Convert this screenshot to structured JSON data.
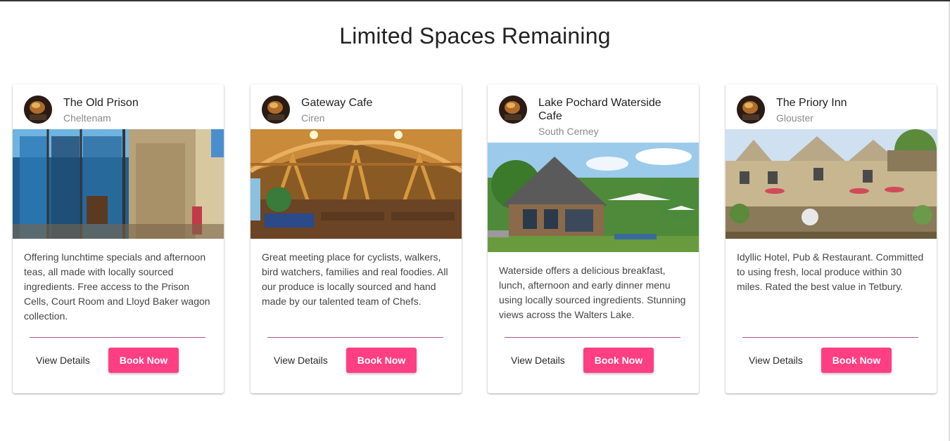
{
  "page": {
    "title": "Limited Spaces Remaining"
  },
  "cards": [
    {
      "title": "The Old Prison",
      "subtitle": "Cheltenam",
      "description": "Offering lunchtime specials and afternoon teas, all made with locally sourced ingredients. Free access to the Prison Cells, Court Room and Lloyd Baker wagon collection.",
      "view_label": "View Details",
      "book_label": "Book Now",
      "image": "cafe-exterior-photo"
    },
    {
      "title": "Gateway Cafe",
      "subtitle": "Ciren",
      "description": "Great meeting place for cyclists, walkers, bird watchers, families and real foodies. All our produce is locally sourced and hand made by our talented team of Chefs.",
      "view_label": "View Details",
      "book_label": "Book Now",
      "image": "timber-hall-interior-photo"
    },
    {
      "title": "Lake Pochard Waterside Cafe",
      "subtitle": "South Cerney",
      "description": "Waterside offers a delicious breakfast, lunch, afternoon and early dinner menu using locally sourced ingredients. Stunning views across the Walters Lake.",
      "view_label": "View Details",
      "book_label": "Book Now",
      "image": "lakeside-cafe-photo"
    },
    {
      "title": "The Priory Inn",
      "subtitle": "Glouster",
      "description": "Idyllic Hotel, Pub & Restaurant. Committed to using fresh, local produce within 30 miles. Rated the best value in Tetbury.",
      "view_label": "View Details",
      "book_label": "Book Now",
      "image": "stone-inn-photo"
    }
  ],
  "colors": {
    "accent": "#ff3f81",
    "divider": "#b0578b",
    "subtitle": "#8a8a8a",
    "text": "#454545"
  }
}
